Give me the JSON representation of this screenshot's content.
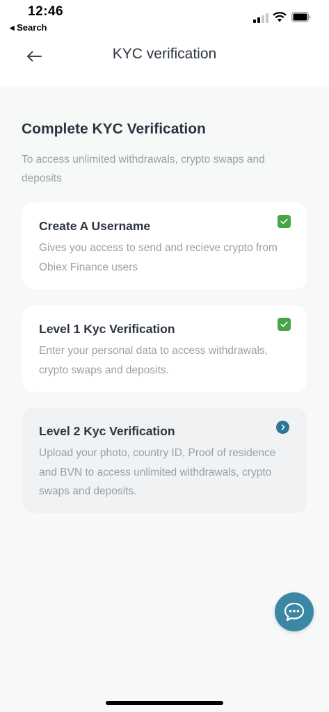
{
  "status_bar": {
    "time": "12:46",
    "back_app_label": "◂ Search"
  },
  "header": {
    "title": "KYC verification"
  },
  "section": {
    "title": "Complete KYC Verification",
    "subtitle": "To access unlimited withdrawals, crypto swaps and deposits"
  },
  "cards": [
    {
      "title": "Create A Username",
      "description": "Gives you access to send and recieve crypto from Obiex Finance users",
      "status": "completed"
    },
    {
      "title": "Level 1 Kyc Verification",
      "description": "Enter your personal data to access withdrawals, crypto swaps and deposits.",
      "status": "completed"
    },
    {
      "title": "Level 2 Kyc Verification",
      "description": "Upload your photo, country ID, Proof of residence and BVN to access unlimited withdrawals, crypto swaps and deposits.",
      "status": "pending"
    }
  ],
  "icons": {
    "back": "arrow-left-icon",
    "check": "checkmark-icon",
    "next": "chevron-right-icon",
    "chat": "chat-bubble-icon"
  },
  "colors": {
    "check_green": "#47a447",
    "accent_blue": "#2f7596",
    "chat_fab": "#3b88a5",
    "background": "#f7f8f8"
  }
}
